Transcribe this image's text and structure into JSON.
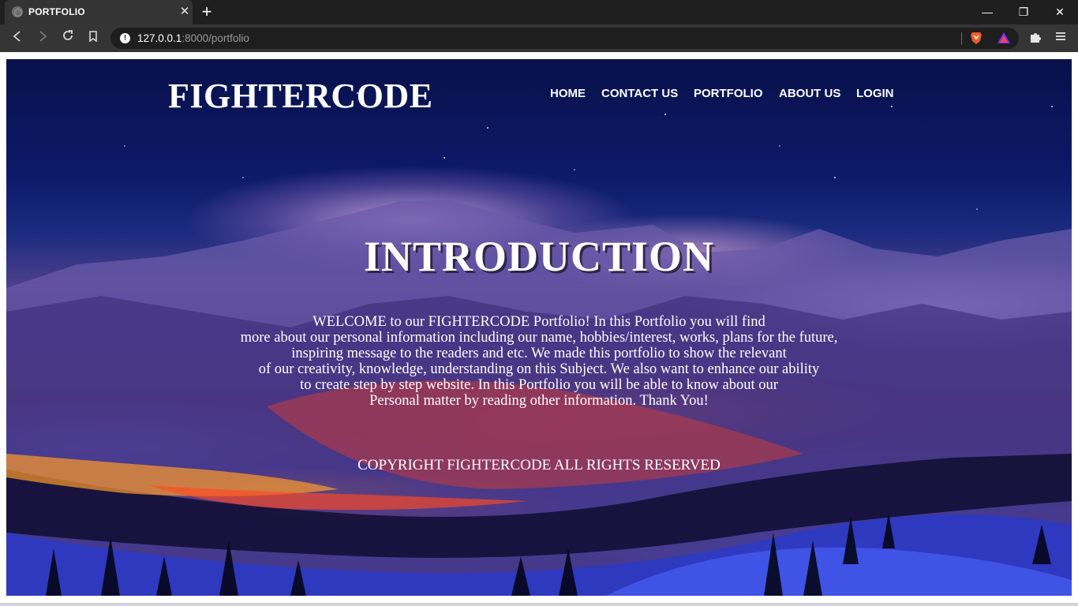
{
  "browser": {
    "tab_title": "PORTFOLIO",
    "tab_close": "✕",
    "new_tab": "+",
    "url_host": "127.0.0.1",
    "url_path": ":8000/portfolio",
    "window": {
      "minimize": "—",
      "restore": "❐",
      "close": "✕"
    },
    "icons": [
      "back-icon",
      "forward-icon",
      "reload-icon",
      "bookmark-icon",
      "info-icon",
      "brave-shield-icon",
      "brave-rewards-icon",
      "extensions-icon",
      "menu-icon"
    ]
  },
  "site": {
    "logo": "FIGHTERCODE",
    "nav": [
      "HOME",
      "CONTACT US",
      "PORTFOLIO",
      "ABOUT US",
      "LOGIN"
    ],
    "intro_title": "INTRODUCTION",
    "intro_lines": [
      "WELCOME to our FIGHTERCODE Portfolio! In this Portfolio you will find",
      "more about our personal information including our name, hobbies/interest, works, plans for the future,",
      "inspiring message to the readers and etc. We made this portfolio to show the relevant",
      "of our creativity, knowledge, understanding on this Subject. We also want to enhance our ability",
      "to create step by step website. In this Portfolio you will be able to know about our",
      "Personal matter by reading other information. Thank You!"
    ],
    "copyright": "COPYRIGHT FIGHTERCODE ALL RIGHTS RESERVED"
  },
  "colors": {
    "chrome_dark": "#1f1f1f",
    "toolbar": "#353535",
    "sky": "#0d1a6a",
    "snow_blue": "#2e3fd0",
    "glow_orange": "#ff7814"
  }
}
